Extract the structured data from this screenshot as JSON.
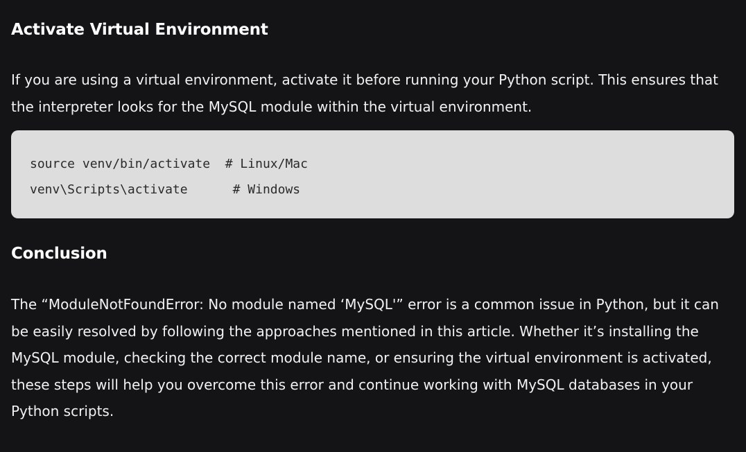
{
  "sections": [
    {
      "heading": "Activate Virtual Environment",
      "paragraph": "If you are using a virtual environment, activate it before running your Python script. This ensures that the interpreter looks for the MySQL module within the virtual environment.",
      "code_lines": [
        "source venv/bin/activate  # Linux/Mac",
        "venv\\Scripts\\activate      # Windows"
      ]
    },
    {
      "heading": "Conclusion",
      "paragraph": "The “ModuleNotFoundError: No module named ‘MySQL'” error is a common issue in Python, but it can be easily resolved by following the approaches mentioned in this article. Whether it’s installing the MySQL module, checking the correct module name, or ensuring the virtual environment is activated, these steps will help you overcome this error and continue working with MySQL databases in your Python scripts."
    }
  ]
}
